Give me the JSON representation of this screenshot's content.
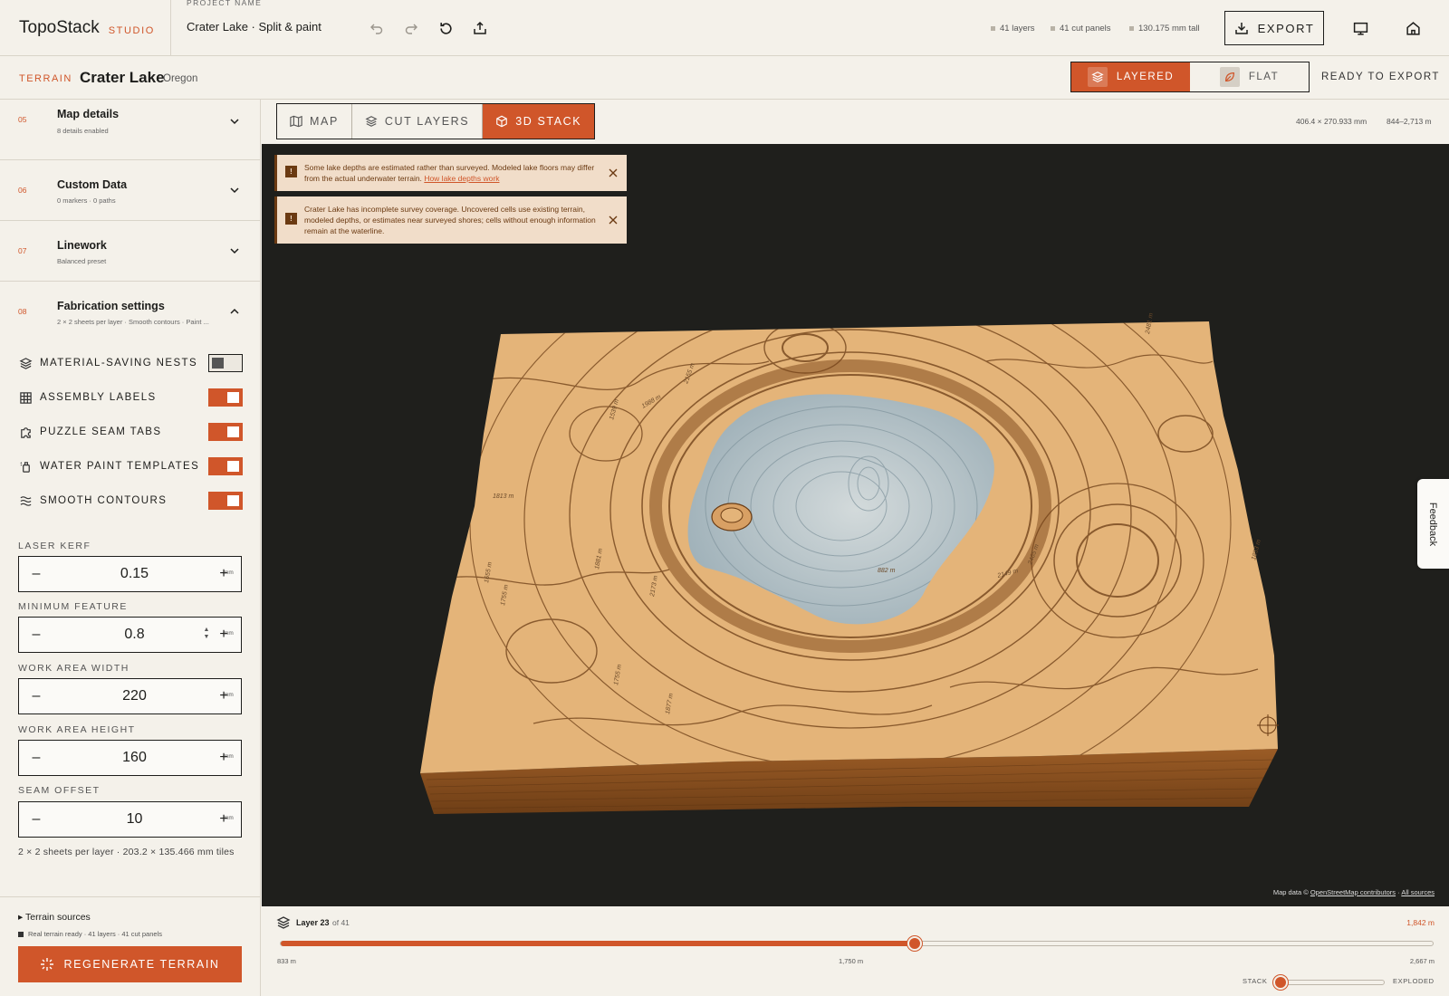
{
  "brand": {
    "name": "TopoStack",
    "tag": "STUDIO"
  },
  "project": {
    "label": "PROJECT NAME",
    "name": "Crater Lake · Split & paint"
  },
  "toolbar_icons": [
    "undo-icon",
    "redo-icon",
    "reset-icon",
    "share-icon"
  ],
  "stats": {
    "layers": "41 layers",
    "panels": "41 cut panels",
    "height": "130.175 mm tall"
  },
  "export_label": "EXPORT",
  "terrain": {
    "kw": "TERRAIN",
    "name": "Crater Lake",
    "region": "Oregon"
  },
  "modes": {
    "layered": "LAYERED",
    "flat": "FLAT",
    "active": "layered"
  },
  "ready_label": "READY TO EXPORT",
  "sections": [
    {
      "num": "05",
      "title": "Map details",
      "sub": "8 details enabled",
      "expanded": false
    },
    {
      "num": "06",
      "title": "Custom Data",
      "sub": "0 markers · 0 paths",
      "expanded": false
    },
    {
      "num": "07",
      "title": "Linework",
      "sub": "Balanced preset",
      "expanded": false
    },
    {
      "num": "08",
      "title": "Fabrication settings",
      "sub": "2 × 2 sheets per layer · Smooth contours · Paint ...",
      "expanded": true
    }
  ],
  "toggles": [
    {
      "label": "MATERIAL-SAVING NESTS",
      "on": false,
      "icon": "layers-icon"
    },
    {
      "label": "ASSEMBLY LABELS",
      "on": true,
      "icon": "grid-icon"
    },
    {
      "label": "PUZZLE SEAM TABS",
      "on": true,
      "icon": "puzzle-icon"
    },
    {
      "label": "WATER PAINT TEMPLATES",
      "on": true,
      "icon": "paint-bottle-icon"
    },
    {
      "label": "SMOOTH CONTOURS",
      "on": true,
      "icon": "waves-icon"
    }
  ],
  "fields": [
    {
      "label": "LASER KERF",
      "value": "0.15",
      "unit": "mm"
    },
    {
      "label": "MINIMUM FEATURE",
      "value": "0.8",
      "unit": "mm"
    },
    {
      "label": "WORK AREA WIDTH",
      "value": "220",
      "unit": "mm"
    },
    {
      "label": "WORK AREA HEIGHT",
      "value": "160",
      "unit": "mm"
    },
    {
      "label": "SEAM OFFSET",
      "value": "10",
      "unit": "mm"
    }
  ],
  "sheets_note": "2 × 2 sheets per layer · 203.2 × 135.466 mm tiles",
  "sources": {
    "toggle": "Terrain sources",
    "status": "Real terrain ready · 41 layers · 41 cut panels"
  },
  "regen_label": "REGENERATE TERRAIN",
  "view_tabs": [
    {
      "label": "MAP",
      "icon": "map-icon"
    },
    {
      "label": "CUT LAYERS",
      "icon": "layers-icon"
    },
    {
      "label": "3D STACK",
      "icon": "cube-icon"
    }
  ],
  "active_view": "3D STACK",
  "dims": {
    "size": "406.4 × 270.933 mm",
    "range": "844–2,713 m"
  },
  "notices": [
    {
      "text": "Some lake depths are estimated rather than surveyed. Modeled lake floors may differ from the actual underwater terrain.",
      "link": "How lake depths work"
    },
    {
      "text": "Crater Lake has incomplete survey coverage. Uncovered cells use existing terrain, modeled depths, or estimates near surveyed shores; cells without enough information remain at the waterline."
    }
  ],
  "contour_labels": [
    "1813 m",
    "1988 m",
    "2155 m",
    "2481 m",
    "1539 m",
    "1655 m",
    "1755 m",
    "2173 m",
    "1881 m",
    "1755 m",
    "1877 m",
    "2465 m",
    "2149 m",
    "882 m",
    "1853 m"
  ],
  "attrib": {
    "prefix": "Map data ©",
    "osm": "OpenStreetMap contributors",
    "sep": " · ",
    "all": "All sources"
  },
  "feedback_label": "Feedback",
  "layer": {
    "label": "Layer 23",
    "of": "of 41",
    "current": 23,
    "total": 41,
    "elev": "1,842 m"
  },
  "elev_ticks": {
    "min": "833 m",
    "mid": "1,750 m",
    "max": "2,667 m"
  },
  "explode": {
    "left": "STACK",
    "right": "EXPLODED",
    "value": 0
  },
  "colors": {
    "accent": "#d0562a",
    "terrain": "#e4b479",
    "terrain_side": "#8a5020",
    "water": "#b6c4cc",
    "viewport_bg": "#1f1f1c"
  }
}
